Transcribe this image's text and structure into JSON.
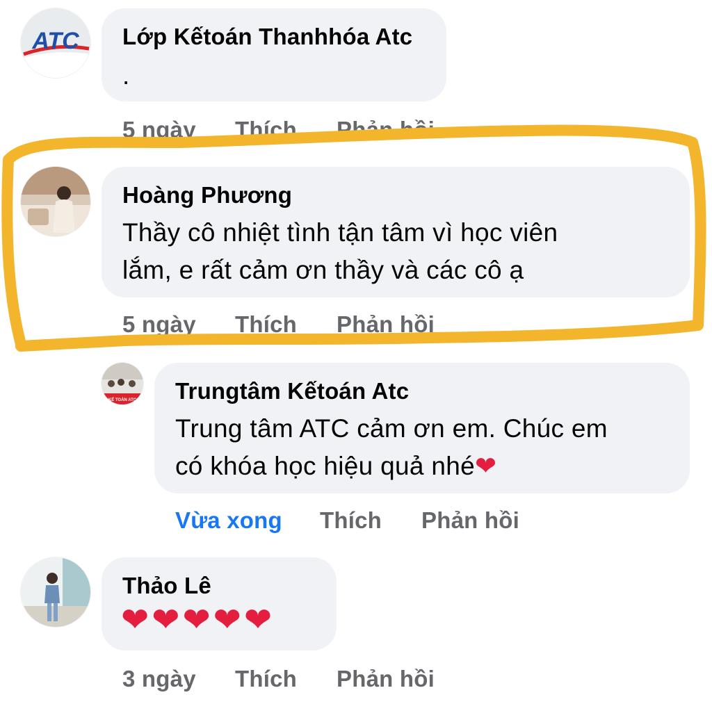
{
  "comments": [
    {
      "author": "Lớp Kếtoán Thanhhóa Atc",
      "text": ".",
      "time": "5 ngày",
      "like": "Thích",
      "reply": "Phản hồi",
      "avatar_text": "ATC"
    },
    {
      "author": "Hoàng Phương",
      "text_line1": "Thầy cô nhiệt tình tận tâm vì học viên",
      "text_line2": "lắm, e rất cảm ơn thầy và các cô ạ",
      "time": "5 ngày",
      "like": "Thích",
      "reply": "Phản hồi"
    },
    {
      "author": "Trungtâm Kếtoán Atc",
      "text_line1": "Trung tâm ATC cảm ơn em. Chúc em",
      "text_line2": "có khóa học hiệu quả nhé",
      "emoji": "❤",
      "time": "Vừa xong",
      "like": "Thích",
      "reply": "Phản hồi",
      "avatar_text": "KẾ TOÁN ATC"
    },
    {
      "author": "Thảo Lê",
      "hearts": "❤❤❤❤❤",
      "time": "3 ngày",
      "like": "Thích",
      "reply": "Phản hồi"
    }
  ],
  "colors": {
    "bubble": "#f0f2f5",
    "action": "#65676b",
    "timestamp_new": "#1877f2",
    "heart": "#e41e3f",
    "highlight": "#f2b52c"
  }
}
